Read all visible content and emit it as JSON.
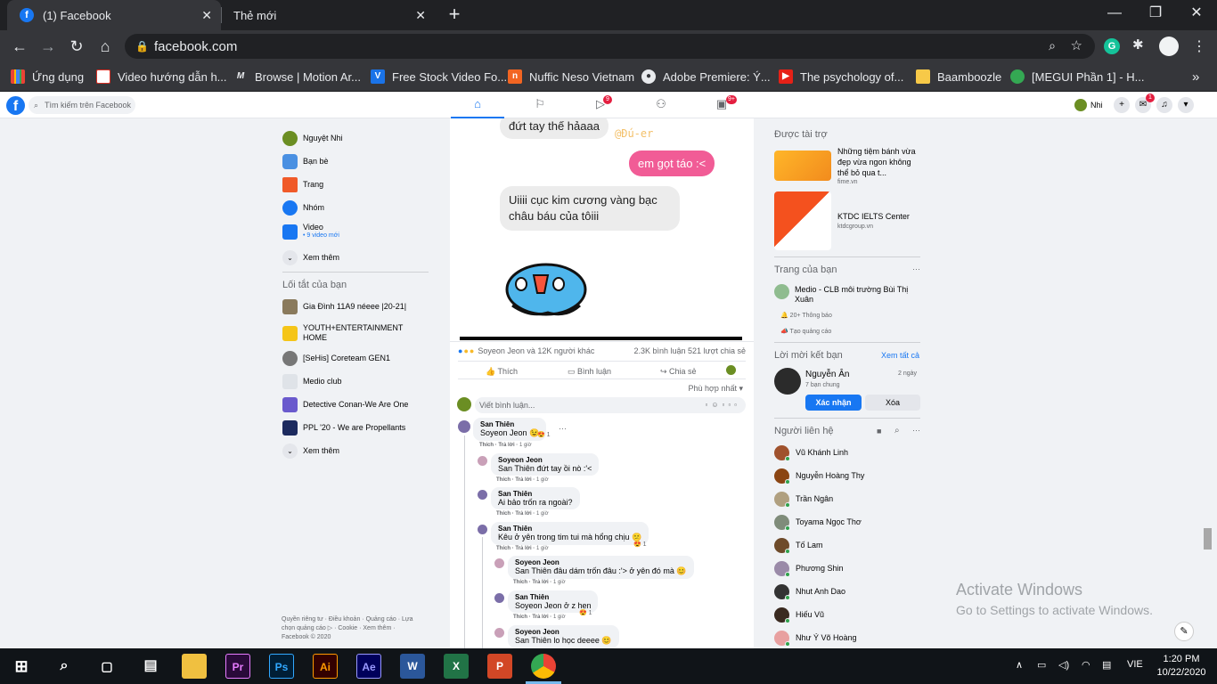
{
  "browser": {
    "tabs": [
      {
        "label": "(1) Facebook",
        "close": "✕"
      },
      {
        "label": "Thẻ mới",
        "close": "✕"
      }
    ],
    "new_tab": "+",
    "window_controls": {
      "minimize": "—",
      "restore": "❐",
      "close": "✕"
    },
    "url": "facebook.com",
    "bookmarks": [
      {
        "label": "Ứng dụng",
        "icon": "apps-grid-icon"
      },
      {
        "label": "Video hướng dẫn h...",
        "icon": "bookmark-red-icon"
      },
      {
        "label": "Browse | Motion Ar...",
        "icon": "motion-array-icon"
      },
      {
        "label": "Free Stock Video Fo...",
        "icon": "videvo-icon"
      },
      {
        "label": "Nuffic Neso Vietnam",
        "icon": "nuffic-icon"
      },
      {
        "label": "Adobe Premiere: Ý...",
        "icon": "globe-icon"
      },
      {
        "label": "The psychology of...",
        "icon": "youtube-icon"
      },
      {
        "label": "Baamboozle",
        "icon": "baamboozle-icon"
      },
      {
        "label": "[MEGUI Phần 1] - H...",
        "icon": "megui-icon"
      }
    ],
    "more_bookmarks": "»"
  },
  "facebook": {
    "logo": "f",
    "search_placeholder": "Tìm kiếm trên Facebook",
    "nav_badges": {
      "watch": "9",
      "gaming": "9+"
    },
    "profile_name": "Nhi",
    "messenger_badge": "1",
    "left_sidebar": {
      "items": [
        {
          "label": "Nguyệt Nhi",
          "sub": ""
        },
        {
          "label": "Bạn bè",
          "sub": ""
        },
        {
          "label": "Trang",
          "sub": ""
        },
        {
          "label": "Nhóm",
          "sub": ""
        },
        {
          "label": "Video",
          "sub": "• 9 video mới"
        },
        {
          "label": "Xem thêm",
          "sub": ""
        }
      ],
      "shortcuts_title": "Lối tắt của bạn",
      "shortcuts": [
        "Gia Đình 11A9 néeee |20-21|",
        "YOUTH+ENTERTAINMENT HOME",
        "[SeHis] Coreteam GEN1",
        "Medio club",
        "Detective Conan-We Are One",
        "PPL '20 - We are Propellants",
        "Xem thêm"
      ],
      "footer": "Quyền riêng tư · Điều khoản · Quảng cáo · Lựa chọn quảng cáo ▷ · Cookie · Xem thêm · Facebook © 2020"
    },
    "post": {
      "bubbles": [
        "đứt tay thế hảaaa",
        "em gọt táo :<",
        "Uiiii cục kim cương vàng bạc châu báu của tôiii"
      ],
      "watermark": "@Đú-er",
      "reactions_text": "Soyeon Jeon và 12K người khác",
      "stats": "2.3K bình luận  521 lượt chia sẻ",
      "actions": {
        "like": "Thích",
        "comment": "Bình luận",
        "share": "Chia sẻ"
      },
      "sort": "Phù hợp nhất",
      "comment_placeholder": "Viết bình luận...",
      "comments": [
        {
          "name": "San Thiên",
          "text": "Soyeon Jeon 😉",
          "react": "1",
          "time": "1 giờ"
        },
        {
          "name": "Soyeon Jeon",
          "text": "San Thiên đứt tay ồi nò :'<",
          "react": "",
          "time": "1 giờ"
        },
        {
          "name": "San Thiên",
          "text": "Ai bảo trốn ra ngoài?",
          "react": "",
          "time": "1 giờ"
        },
        {
          "name": "San Thiên",
          "text": "Kêu ở yên trong tim tui mà hổng chịu 😕",
          "react": "1",
          "time": "1 giờ"
        },
        {
          "name": "Soyeon Jeon",
          "text": "San Thiên đâu dám trốn đâu :'> ở yên đó mà 😊",
          "react": "",
          "time": "1 giờ"
        },
        {
          "name": "San Thiên",
          "text": "Soyeon Jeon ở z hen",
          "react": "1",
          "time": "1 giờ"
        },
        {
          "name": "Soyeon Jeon",
          "text": "San Thiên lo học deeee 😊",
          "react": "",
          "time": ""
        }
      ],
      "like_label": "Thích",
      "reply_label": "Trả lời"
    },
    "right_rail": {
      "sponsored_title": "Được tài trợ",
      "ads": [
        {
          "text": "Những tiệm bánh vừa đẹp vừa ngon không thể bỏ qua t...",
          "domain": "fime.vn"
        },
        {
          "text": "KTDC IELTS Center",
          "domain": "ktdcgroup.vn"
        }
      ],
      "pages_title": "Trang của bạn",
      "page_name": "Medio - CLB môi trường Bùi Thị Xuân",
      "page_notif": "20+ Thông báo",
      "page_ad": "Tạo quảng cáo",
      "requests_title": "Lời mời kết bạn",
      "see_all": "Xem tất cả",
      "request": {
        "name": "Nguyễn Ân",
        "mutual": "7 bạn chung",
        "time": "2 ngày",
        "confirm": "Xác nhận",
        "delete": "Xóa"
      },
      "contacts_title": "Người liên hệ",
      "contacts": [
        "Vũ Khánh Linh",
        "Nguyễn Hoàng Thy",
        "Trần Ngân",
        "Toyama Ngọc Thơ",
        "Tố Lam",
        "Phương Shin",
        "Nhut Anh Dao",
        "Hiếu Vũ",
        "Như Ý Võ Hoàng"
      ]
    }
  },
  "os": {
    "watermark_title": "Activate Windows",
    "watermark_sub": "Go to Settings to activate Windows.",
    "taskbar_apps": [
      "Pr",
      "Ps",
      "Ai",
      "Ae",
      "W",
      "X",
      "P"
    ],
    "language": "VIE",
    "time": "1:20 PM",
    "date": "10/22/2020"
  }
}
